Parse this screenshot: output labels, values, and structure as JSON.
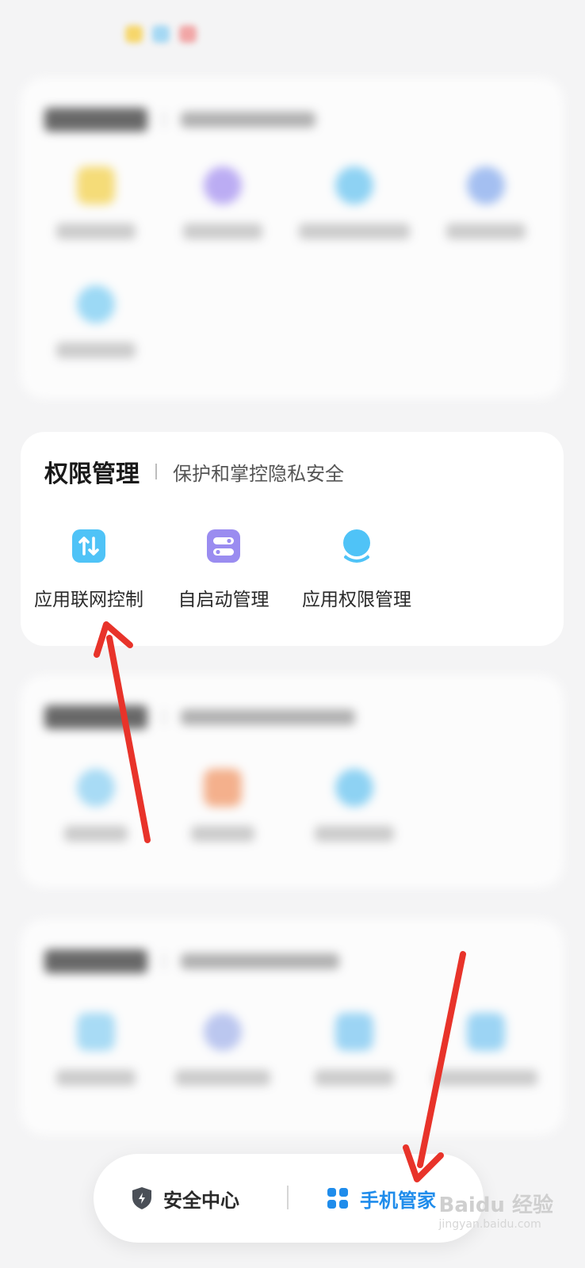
{
  "permission_card": {
    "title": "权限管理",
    "subtitle": "保护和掌控隐私安全",
    "items": [
      {
        "label": "应用联网控制",
        "icon": "network-control-icon"
      },
      {
        "label": "自启动管理",
        "icon": "autostart-icon"
      },
      {
        "label": "应用权限管理",
        "icon": "app-permission-icon"
      }
    ]
  },
  "bottom_nav": {
    "tabs": [
      {
        "label": "安全中心",
        "icon": "shield-icon",
        "active": false
      },
      {
        "label": "手机管家",
        "icon": "grid-icon",
        "active": true
      }
    ]
  },
  "watermark": {
    "text": "Baidu 经验",
    "sub": "jingyan.baidu.com"
  },
  "colors": {
    "accent": "#1f8ceb",
    "network_icon": "#4fc3f7",
    "autostart_icon": "#9a8cf0",
    "permission_icon": "#4fc3f7",
    "arrow": "#e8332a"
  }
}
